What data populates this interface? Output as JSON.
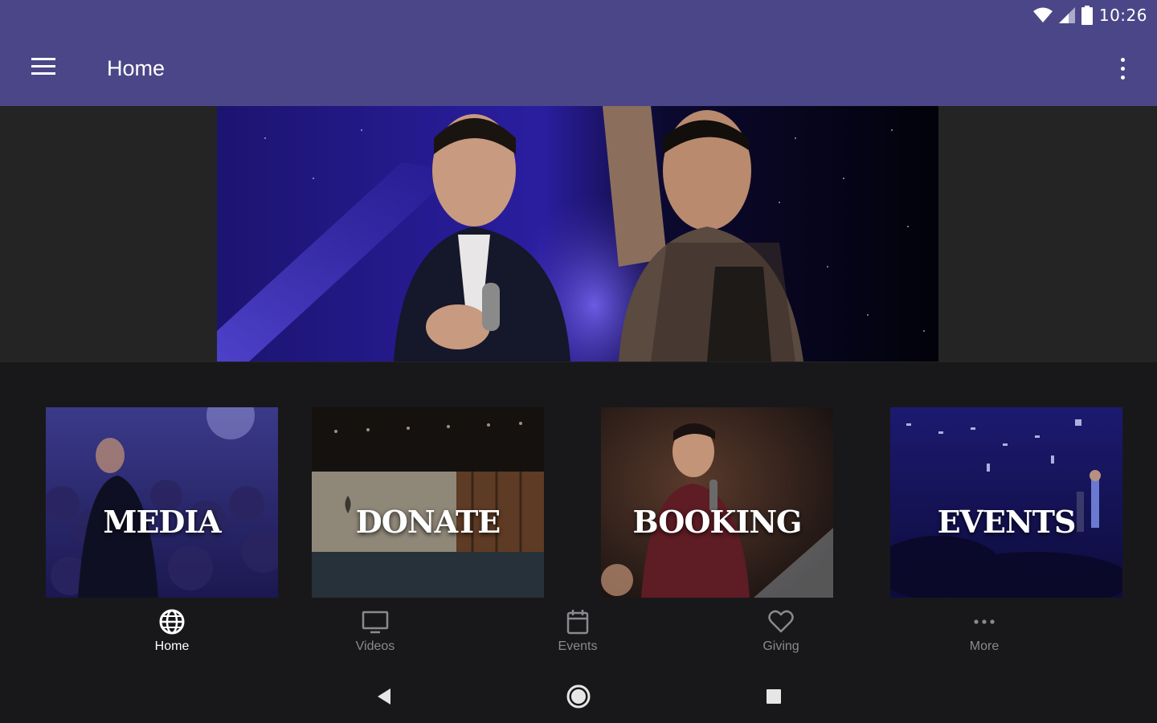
{
  "status_bar": {
    "time": "10:26"
  },
  "app_bar": {
    "title": "Home"
  },
  "tiles": [
    {
      "label": "MEDIA"
    },
    {
      "label": "DONATE"
    },
    {
      "label": "BOOKING"
    },
    {
      "label": "EVENTS"
    }
  ],
  "bottom_nav": [
    {
      "label": "Home",
      "icon": "globe-icon",
      "active": true
    },
    {
      "label": "Videos",
      "icon": "tv-icon",
      "active": false
    },
    {
      "label": "Events",
      "icon": "calendar-icon",
      "active": false
    },
    {
      "label": "Giving",
      "icon": "heart-icon",
      "active": false
    },
    {
      "label": "More",
      "icon": "more-horizontal-icon",
      "active": false
    }
  ],
  "colors": {
    "app_bar": "#4b4687",
    "background": "#18181b",
    "active": "#ffffff",
    "inactive": "#8a8a8e"
  }
}
